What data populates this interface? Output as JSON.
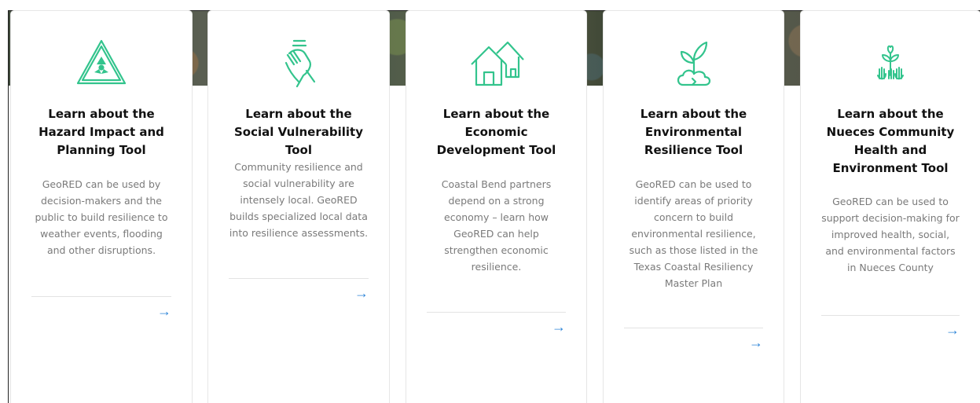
{
  "cards": [
    {
      "title": "Learn about the Hazard Impact and Planning Tool",
      "description": "GeoRED can be used by decision-makers and the public to build resilience to weather events, flooding and other disruptions.",
      "icon": "hazard-warning-icon",
      "arrow": "→"
    },
    {
      "title": "Learn about the Social Vulnerability Tool",
      "description": "Community resilience and social vulnerability are intensely local. GeoRED builds specialized local data into resilience assessments.",
      "icon": "handshake-icon",
      "arrow": "→"
    },
    {
      "title": "Learn about the Economic Development Tool",
      "description": "Coastal Bend partners depend on a strong economy – learn how GeoRED can help strengthen economic resilience.",
      "icon": "houses-icon",
      "arrow": "→"
    },
    {
      "title": "Learn about the Environmental Resilience Tool",
      "description": "GeoRED can be used to identify areas of priority concern to build environmental resilience, such as those listed in the Texas Coastal Resiliency Master Plan",
      "icon": "sprout-icon",
      "arrow": "→"
    },
    {
      "title": "Learn about the Nueces Community Health and Environment Tool",
      "description": "GeoRED can be used to support decision-making for improved health, social, and environmental factors in Nueces County",
      "icon": "community-health-icon",
      "arrow": "→"
    }
  ],
  "colors": {
    "accent": "#33c48d",
    "link": "#2f86d8"
  }
}
